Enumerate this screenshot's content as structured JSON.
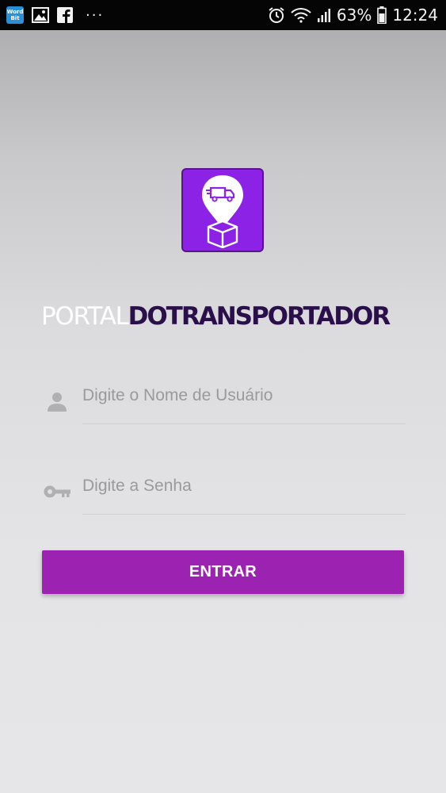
{
  "status_bar": {
    "notification_app_label": "Word\nBit",
    "battery": "63%",
    "time": "12:24",
    "more": "···"
  },
  "brand": {
    "part1": "PORTAL",
    "part2": "DOTRANSPORTADOR",
    "primary_color": "#8b22e6"
  },
  "login": {
    "username_placeholder": "Digite o Nome de Usuário",
    "password_placeholder": "Digite a Senha",
    "submit_label": "ENTRAR",
    "button_color": "#9c22b2"
  }
}
